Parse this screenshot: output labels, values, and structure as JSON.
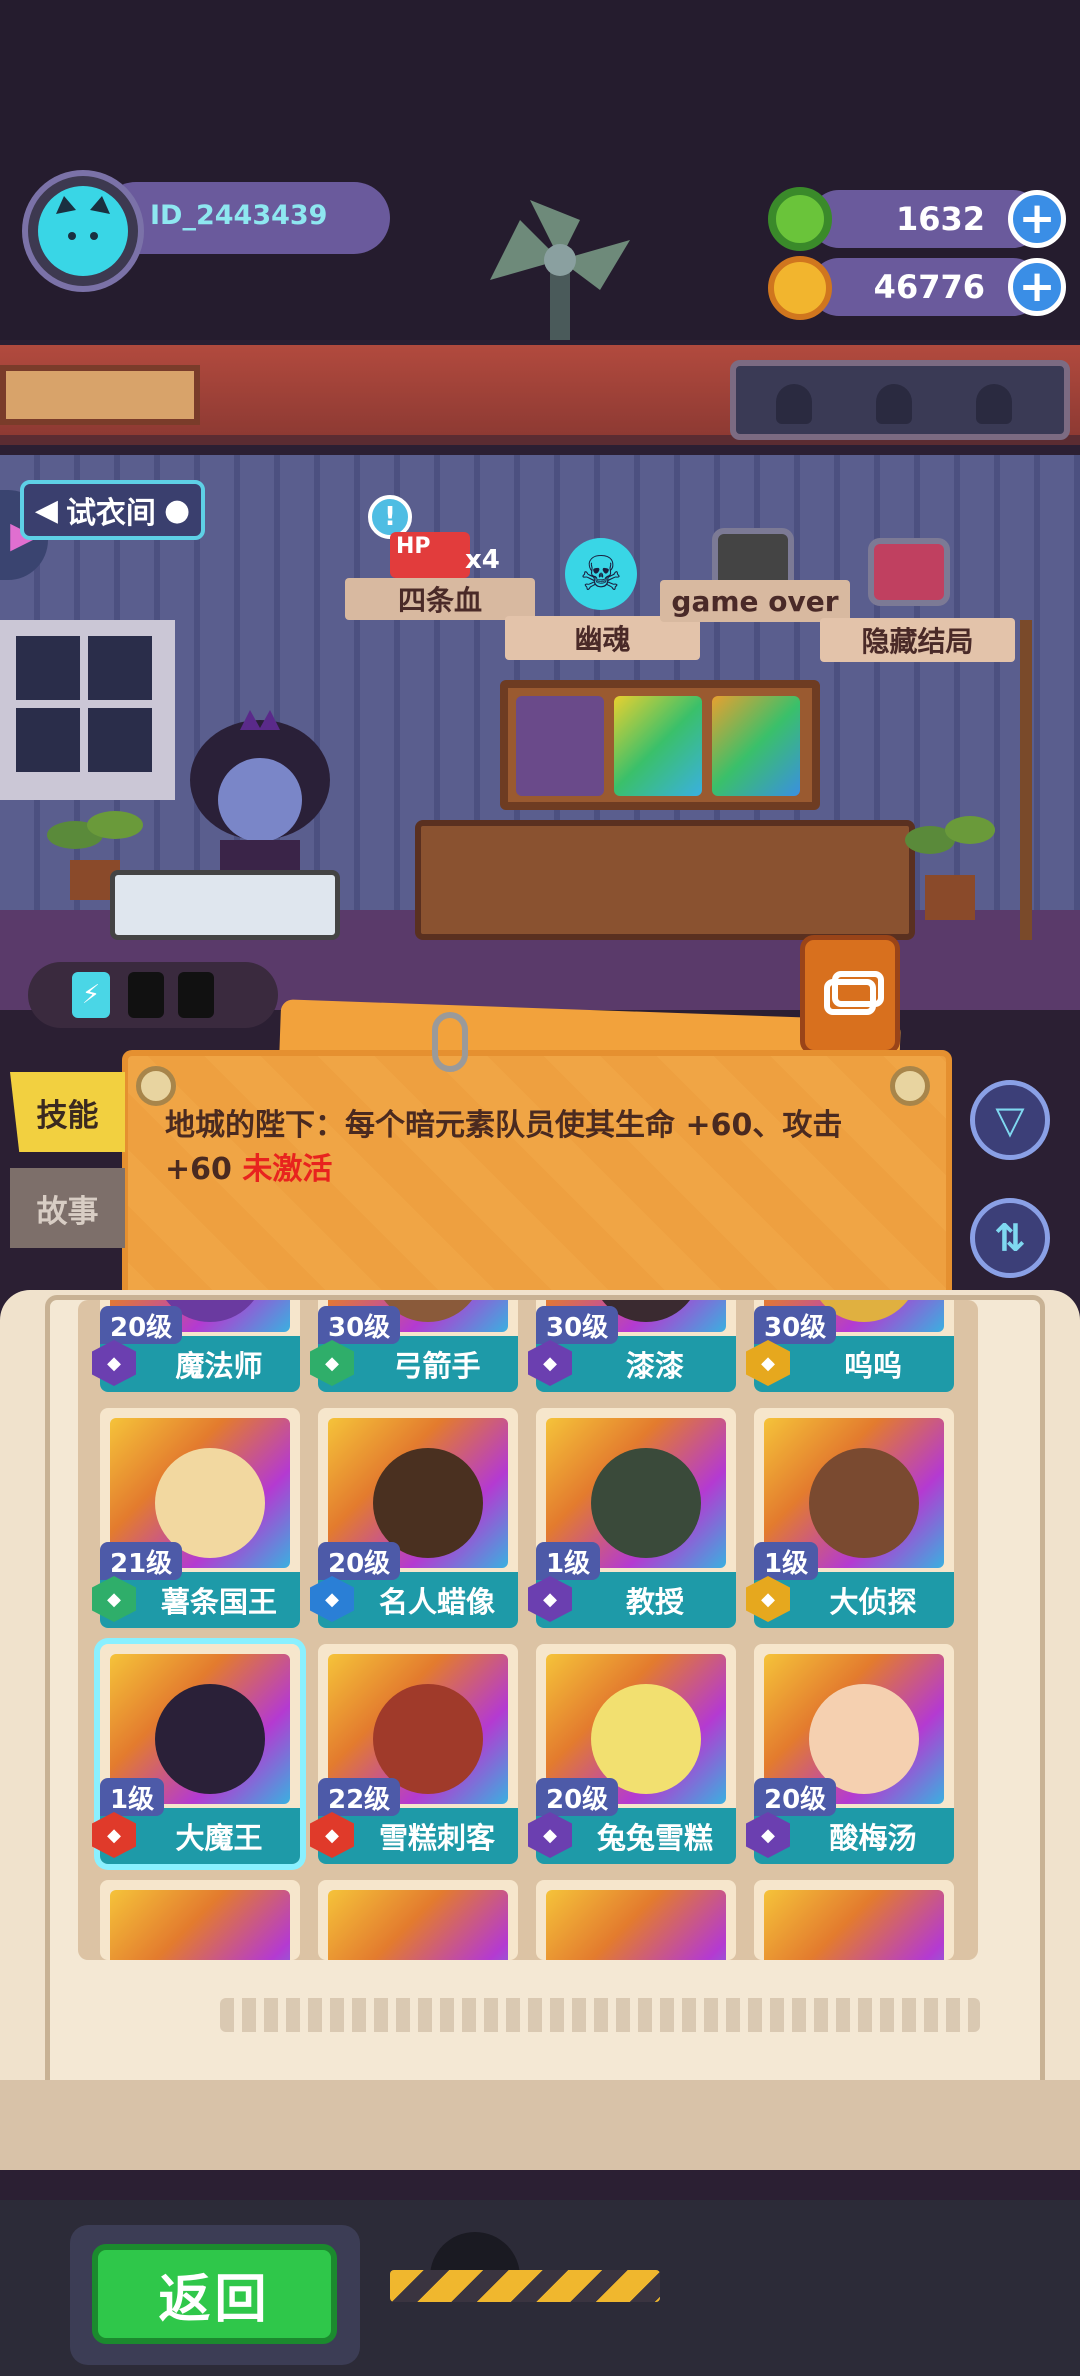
{
  "hud": {
    "user_id": "ID_2443439",
    "currency_1": {
      "icon": "green-donut-icon",
      "value": "1632",
      "plus": "+"
    },
    "currency_2": {
      "icon": "gold-planet-icon",
      "value": "46776",
      "plus": "+"
    }
  },
  "fitting_room": {
    "label": "试衣间"
  },
  "endings": {
    "hp_badge": "HP",
    "hp_multiplier": "x4",
    "info_mark": "!",
    "items": [
      {
        "title": "四条血",
        "subtitle": ""
      },
      {
        "title": "",
        "subtitle": "幽魂"
      },
      {
        "title": "game over",
        "subtitle": ""
      },
      {
        "title": "",
        "subtitle": "隐藏结局"
      }
    ]
  },
  "tabs": {
    "skill": "技能",
    "story": "故事"
  },
  "skill_board": {
    "text": "地城的陛下：每个暗元素队员使其生命 +60、攻击 +60 ",
    "status": "未激活"
  },
  "heroes": [
    {
      "level": "20级",
      "name": "魔法师",
      "element": "dark",
      "color": "#6b3fb0"
    },
    {
      "level": "30级",
      "name": "弓箭手",
      "element": "wind",
      "color": "#2fae6a"
    },
    {
      "level": "30级",
      "name": "漆漆",
      "element": "dark",
      "color": "#6b3fb0"
    },
    {
      "level": "30级",
      "name": "呜呜",
      "element": "light",
      "color": "#e6a81e"
    },
    {
      "level": "21级",
      "name": "薯条国王",
      "element": "wind",
      "color": "#2fae6a"
    },
    {
      "level": "20级",
      "name": "名人蜡像",
      "element": "water",
      "color": "#2a7fd6"
    },
    {
      "level": "1级",
      "name": "教授",
      "element": "dark",
      "color": "#6b3fb0"
    },
    {
      "level": "1级",
      "name": "大侦探",
      "element": "light",
      "color": "#e6a81e"
    },
    {
      "level": "1级",
      "name": "大魔王",
      "element": "fire",
      "color": "#e03a2a"
    },
    {
      "level": "22级",
      "name": "雪糕刺客",
      "element": "fire",
      "color": "#e03a2a"
    },
    {
      "level": "20级",
      "name": "兔兔雪糕",
      "element": "dark",
      "color": "#6b3fb0"
    },
    {
      "level": "20级",
      "name": "酸梅汤",
      "element": "dark",
      "color": "#6b3fb0"
    }
  ],
  "back_button": "返回"
}
